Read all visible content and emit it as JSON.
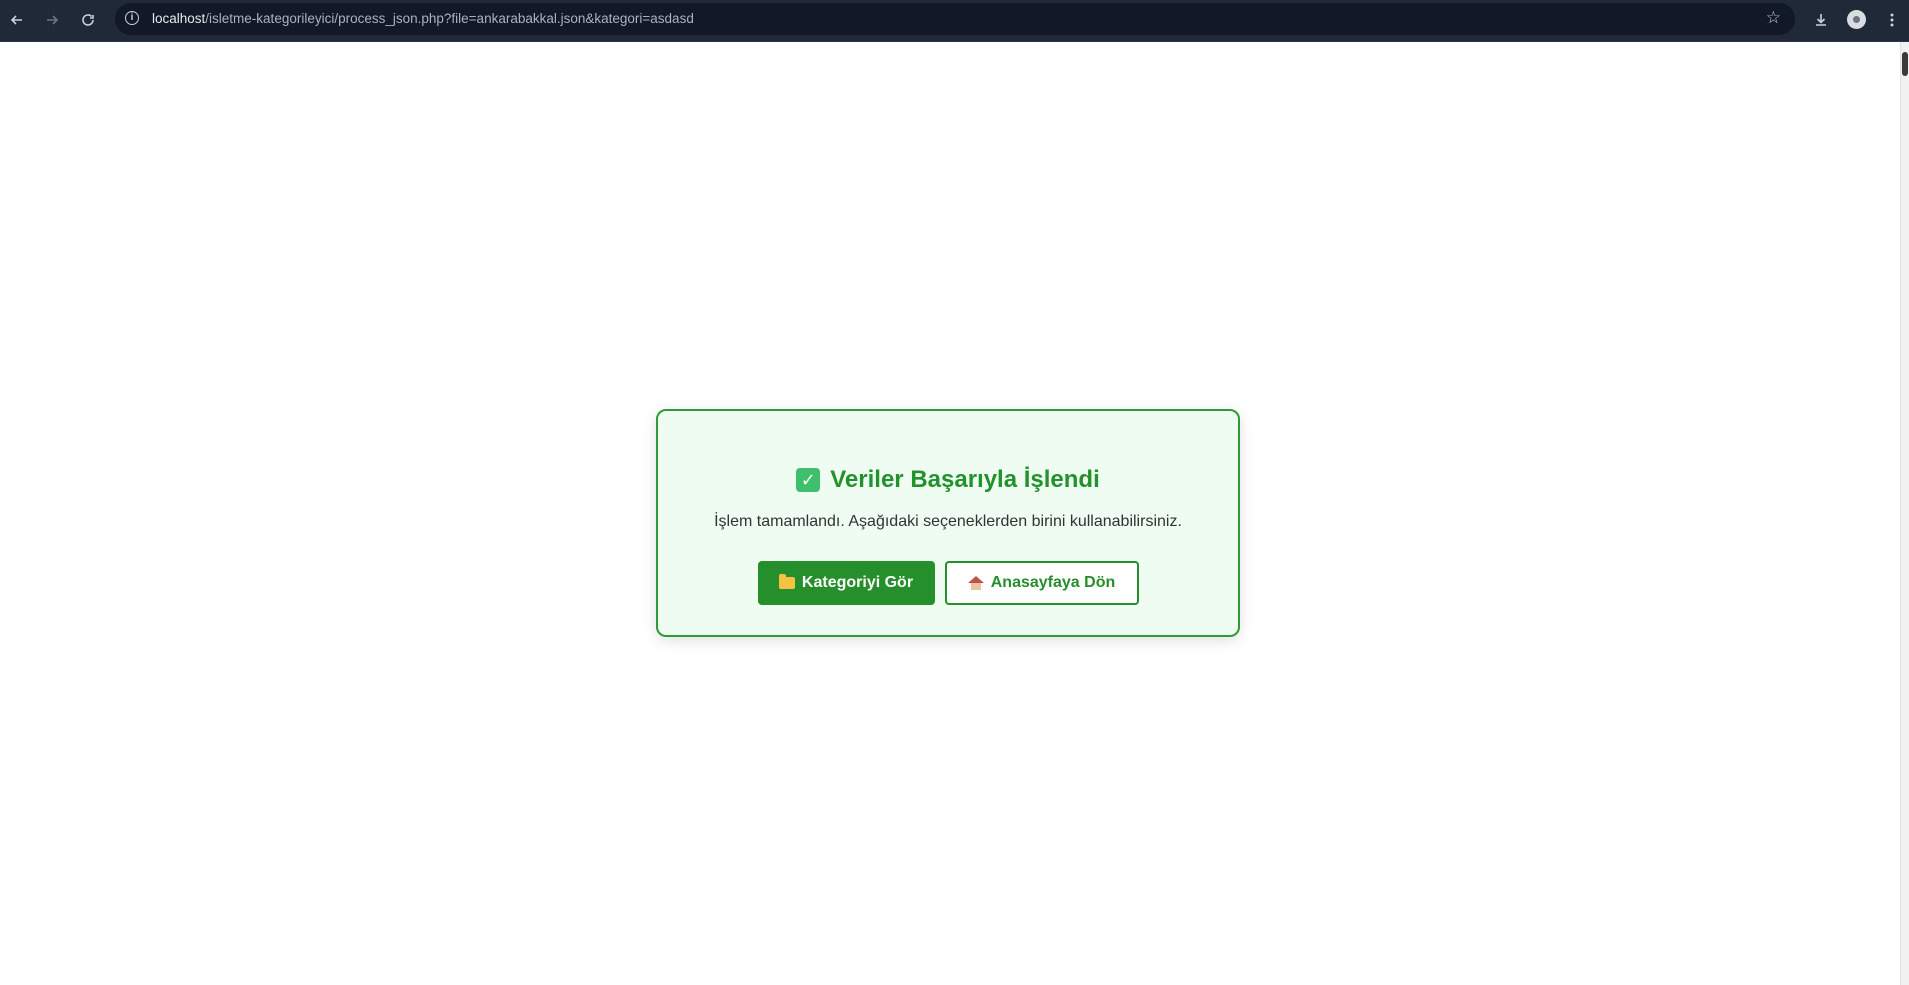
{
  "browser": {
    "url_host": "localhost",
    "url_path": "/isletme-kategorileyici/process_json.php?file=ankarabakkal.json&kategori=asdasd",
    "icons": {
      "back": "arrow-left-icon",
      "forward": "arrow-right-icon",
      "reload": "reload-icon",
      "site_info": "info-icon",
      "bookmark": "star-icon",
      "download": "download-icon",
      "profile": "avatar",
      "menu": "kebab-menu-icon"
    }
  },
  "card": {
    "title": "Veriler Başarıyla İşlendi",
    "title_icon": "check-icon",
    "message": "İşlem tamamlandı. Aşağıdaki seçeneklerden birini kullanabilirsiniz.",
    "buttons": {
      "view_category": {
        "label": "Kategoriyi Gör",
        "icon": "folder-icon"
      },
      "go_home": {
        "label": "Anasayfaya Dön",
        "icon": "home-icon"
      }
    }
  },
  "colors": {
    "success_green": "#248f2b",
    "card_background": "#eefcf2",
    "browser_toolbar": "#1f2937"
  }
}
